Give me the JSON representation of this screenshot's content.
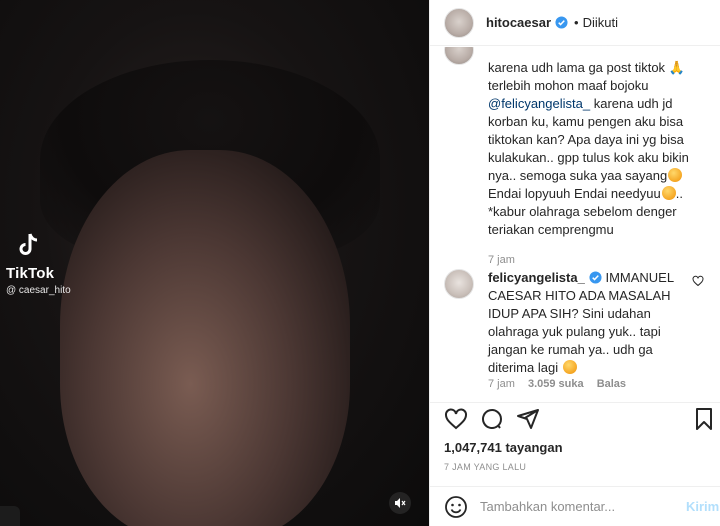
{
  "media": {
    "watermark_name": "TikTok",
    "watermark_handle": "@ caesar_hito",
    "volume_icon": "muted-speaker-icon"
  },
  "header": {
    "username": "hitocaesar",
    "separator": "•",
    "follow_status": "Diikuti"
  },
  "caption": {
    "lines": [
      "karena udh lama ga post tiktok",
      "terlebih mohon maaf bojoku",
      "karena udh jd",
      "korban ku, kamu pengen aku bisa",
      "tiktokan kan? Apa daya ini yg bisa",
      "kulakukan.. gpp tulus kok aku bikin",
      "nya.. semoga suka yaa sayang",
      "Endai lopyuuh Endai needyuu",
      "*kabur olahraga sebelom denger",
      "teriakan cemprengmu"
    ],
    "mention": "@felicyangelista_",
    "time": "7 jam"
  },
  "comment": {
    "username": "felicyangelista_",
    "lines": [
      "IMMANUEL",
      "CAESAR HITO ADA MASALAH",
      "IDUP APA SIH? Sini udahan",
      "olahraga yuk pulang yuk.. tapi",
      "jangan ke rumah ya.. udh ga",
      "diterima lagi"
    ],
    "time": "7 jam",
    "likes": "3.059 suka",
    "reply": "Balas"
  },
  "stats": {
    "views": "1,047,741 tayangan",
    "posted": "7 JAM YANG LALU"
  },
  "comment_box": {
    "placeholder": "Tambahkan komentar...",
    "post_label": "Kirim"
  },
  "colors": {
    "verified": "#3897f0",
    "mention": "#00376b",
    "post_disabled": "#b2dffc"
  }
}
